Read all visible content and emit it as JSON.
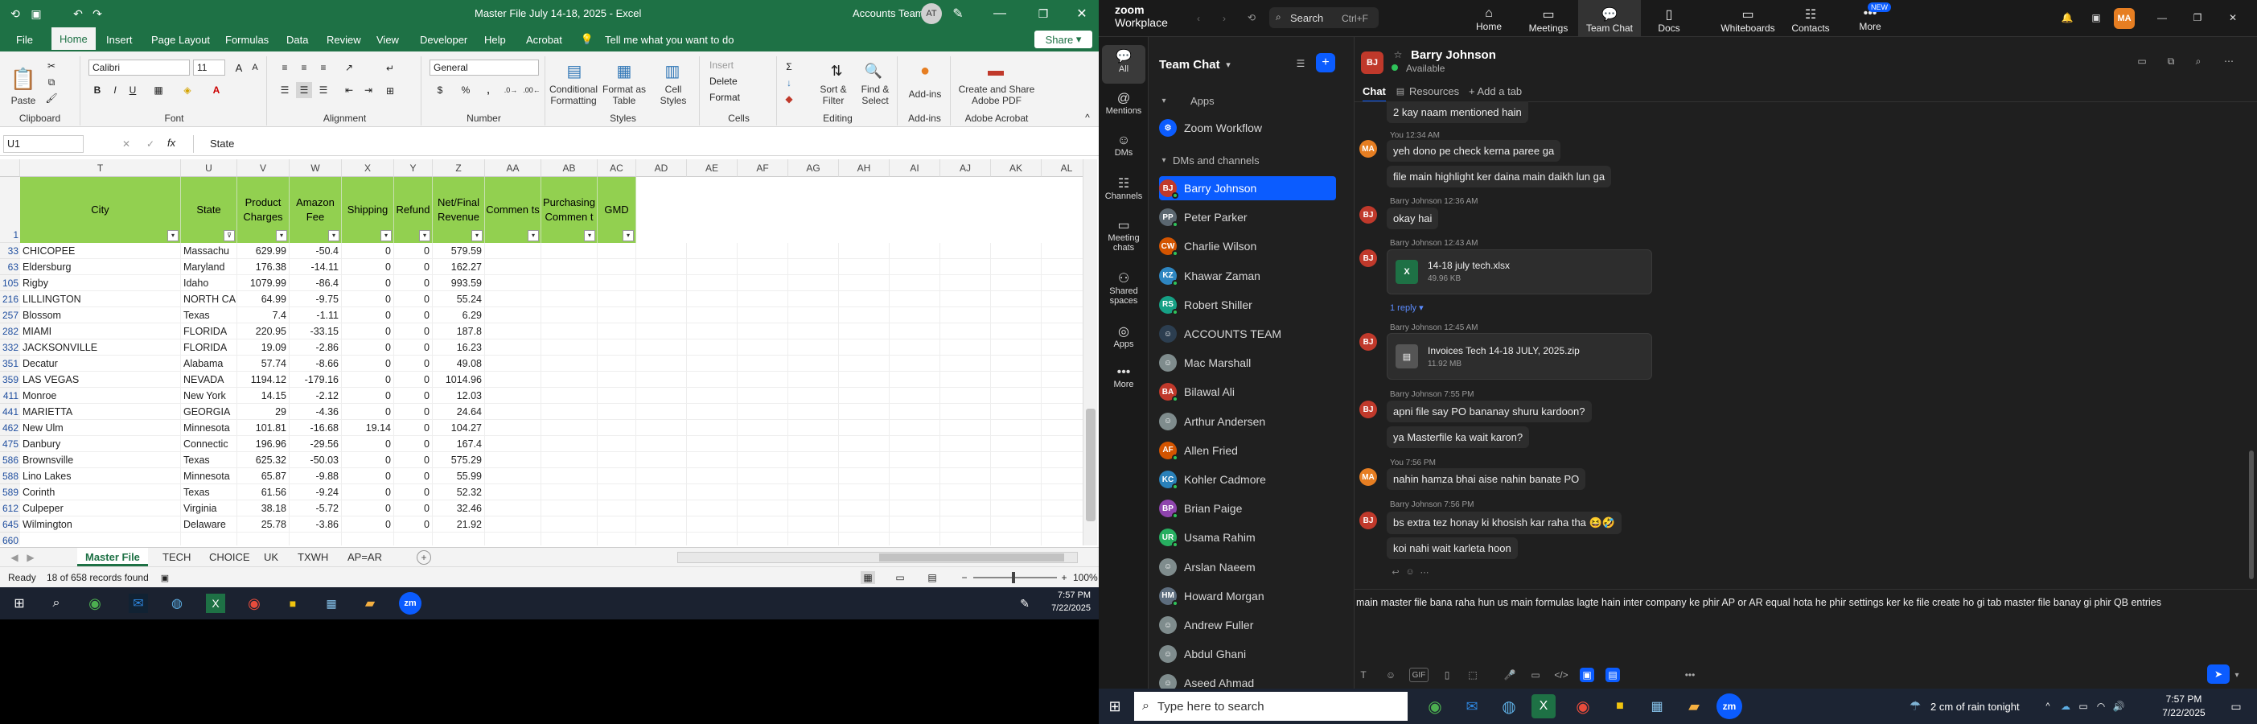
{
  "excel": {
    "title": "Master File July 14-18, 2025 - Excel",
    "account_name": "Accounts Team",
    "account_initials": "AT",
    "share": "Share",
    "tabs": [
      "File",
      "Home",
      "Insert",
      "Page Layout",
      "Formulas",
      "Data",
      "Review",
      "View",
      "Developer",
      "Help",
      "Acrobat"
    ],
    "tell_me": "Tell me what you want to do",
    "ribbon": {
      "font_name": "Calibri",
      "font_size": "11",
      "number_format": "General",
      "groups": {
        "clipboard": "Clipboard",
        "font": "Font",
        "alignment": "Alignment",
        "number": "Number",
        "styles": "Styles",
        "cells": "Cells",
        "editing": "Editing",
        "addins": "Add-ins",
        "acrobat": "Adobe Acrobat"
      },
      "paste": "Paste",
      "cond_format": "Conditional Formatting",
      "format_table": "Format as Table",
      "cell_styles": "Cell Styles",
      "insert": "Insert",
      "delete": "Delete",
      "format": "Format",
      "sort_filter": "Sort & Filter",
      "find_select": "Find & Select",
      "addins": "Add-ins",
      "create_pdf": "Create and Share Adobe PDF"
    },
    "name_box": "U1",
    "fx": "fx",
    "formula_value": "State",
    "col_letters": [
      "T",
      "U",
      "V",
      "W",
      "X",
      "Y",
      "Z",
      "AA",
      "AB",
      "AC",
      "AD",
      "AE",
      "AF",
      "AG",
      "AH",
      "AI",
      "AJ",
      "AK",
      "AL"
    ],
    "headers": [
      "City",
      "State",
      "Product Charges",
      "Amazon Fee",
      "Shipping",
      "Refund",
      "Net/Final Revenue",
      "Commen ts",
      "Purchasing Commen t",
      "GMD"
    ],
    "header_row_num": "1",
    "rows": [
      [
        "33",
        "CHICOPEE",
        "Massachu",
        "629.99",
        "-50.4",
        "0",
        "0",
        "579.59"
      ],
      [
        "63",
        "Eldersburg",
        "Maryland",
        "176.38",
        "-14.11",
        "0",
        "0",
        "162.27"
      ],
      [
        "105",
        "Rigby",
        "Idaho",
        "1079.99",
        "-86.4",
        "0",
        "0",
        "993.59"
      ],
      [
        "216",
        "LILLINGTON",
        "NORTH CA",
        "64.99",
        "-9.75",
        "0",
        "0",
        "55.24"
      ],
      [
        "257",
        "Blossom",
        "Texas",
        "7.4",
        "-1.11",
        "0",
        "0",
        "6.29"
      ],
      [
        "282",
        "MIAMI",
        "FLORIDA",
        "220.95",
        "-33.15",
        "0",
        "0",
        "187.8"
      ],
      [
        "332",
        "JACKSONVILLE",
        "FLORIDA",
        "19.09",
        "-2.86",
        "0",
        "0",
        "16.23"
      ],
      [
        "351",
        "Decatur",
        "Alabama",
        "57.74",
        "-8.66",
        "0",
        "0",
        "49.08"
      ],
      [
        "359",
        "LAS VEGAS",
        "NEVADA",
        "1194.12",
        "-179.16",
        "0",
        "0",
        "1014.96"
      ],
      [
        "411",
        "Monroe",
        "New York",
        "14.15",
        "-2.12",
        "0",
        "0",
        "12.03"
      ],
      [
        "441",
        "MARIETTA",
        "GEORGIA",
        "29",
        "-4.36",
        "0",
        "0",
        "24.64"
      ],
      [
        "462",
        "New Ulm",
        "Minnesota",
        "101.81",
        "-16.68",
        "19.14",
        "0",
        "104.27"
      ],
      [
        "475",
        "Danbury",
        "Connectic",
        "196.96",
        "-29.56",
        "0",
        "0",
        "167.4"
      ],
      [
        "586",
        "Brownsville",
        "Texas",
        "625.32",
        "-50.03",
        "0",
        "0",
        "575.29"
      ],
      [
        "588",
        "Lino Lakes",
        "Minnesota",
        "65.87",
        "-9.88",
        "0",
        "0",
        "55.99"
      ],
      [
        "589",
        "Corinth",
        "Texas",
        "61.56",
        "-9.24",
        "0",
        "0",
        "52.32"
      ],
      [
        "612",
        "Culpeper",
        "Virginia",
        "38.18",
        "-5.72",
        "0",
        "0",
        "32.46"
      ],
      [
        "645",
        "Wilmington",
        "Delaware",
        "25.78",
        "-3.86",
        "0",
        "0",
        "21.92"
      ],
      [
        "660",
        "",
        "",
        "",
        "",
        "",
        "",
        ""
      ]
    ],
    "sheets": [
      "Master File",
      "TECH",
      "CHOICE",
      "UK",
      "TXWH",
      "AP=AR"
    ],
    "status_ready": "Ready",
    "status_records": "18 of 658 records found",
    "zoom": "100%"
  },
  "win_taskbar": {
    "time": "7:57 PM",
    "date": "7/22/2025"
  },
  "zoom": {
    "logo_line1": "zoom",
    "logo_line2": "Workplace",
    "search": "Search",
    "search_shortcut": "Ctrl+F",
    "top_nav": [
      "Home",
      "Meetings",
      "Team Chat",
      "Docs",
      "Whiteboards",
      "Contacts",
      "More"
    ],
    "new_badge": "NEW",
    "profile_initials": "MA",
    "rail": [
      "All",
      "Mentions",
      "DMs",
      "Channels",
      "Meeting chats",
      "Shared spaces",
      "Apps",
      "More"
    ],
    "sidebar_title": "Team Chat",
    "apps_section": "Apps",
    "zoom_workflow": "Zoom Workflow",
    "dms_section": "DMs and channels",
    "contacts": [
      {
        "initials": "BJ",
        "name": "Barry Johnson",
        "color": "#c0392b"
      },
      {
        "initials": "PP",
        "name": "Peter Parker",
        "color": "#5b6770"
      },
      {
        "initials": "CW",
        "name": "Charlie Wilson",
        "color": "#d35400"
      },
      {
        "initials": "KZ",
        "name": "Khawar Zaman",
        "color": "#2e86c1"
      },
      {
        "initials": "RS",
        "name": "Robert Shiller",
        "color": "#16a085"
      },
      {
        "initials": "",
        "name": "ACCOUNTS TEAM",
        "color": "#2c3e50"
      },
      {
        "initials": "",
        "name": "Mac Marshall",
        "color": "#7f8c8d"
      },
      {
        "initials": "BA",
        "name": "Bilawal Ali",
        "color": "#c0392b"
      },
      {
        "initials": "",
        "name": "Arthur Andersen",
        "color": "#7f8c8d"
      },
      {
        "initials": "AF",
        "name": "Allen Fried",
        "color": "#d35400"
      },
      {
        "initials": "KC",
        "name": "Kohler Cadmore",
        "color": "#2980b9"
      },
      {
        "initials": "BP",
        "name": "Brian Paige",
        "color": "#8e44ad"
      },
      {
        "initials": "UR",
        "name": "Usama Rahim",
        "color": "#27ae60"
      },
      {
        "initials": "",
        "name": "Arslan Naeem",
        "color": "#7f8c8d"
      },
      {
        "initials": "HM",
        "name": "Howard Morgan",
        "color": "#5d6d7e"
      },
      {
        "initials": "",
        "name": "Andrew Fuller",
        "color": "#7f8c8d"
      },
      {
        "initials": "",
        "name": "Abdul Ghani",
        "color": "#7f8c8d"
      },
      {
        "initials": "",
        "name": "Aseed Ahmad",
        "color": "#7f8c8d"
      }
    ],
    "chat_user": "Barry Johnson",
    "chat_status": "Available",
    "chat_tabs": [
      "Chat",
      "Resources",
      "Add a tab"
    ],
    "messages": {
      "m0": "2 kay naam mentioned hain",
      "m1_meta": "You 12:34 AM",
      "m1": "yeh dono pe check kerna paree ga",
      "m1b": "file main highlight ker daina main daikh lun ga",
      "m2_meta": "Barry Johnson 12:36 AM",
      "m2": "okay hai",
      "m3_meta": "Barry Johnson 12:43 AM",
      "file1_name": "14-18 july tech.xlsx",
      "file1_size": "49.96 KB",
      "reply": "1 reply",
      "m4_meta": "Barry Johnson 12:45 AM",
      "file2_name": "Invoices Tech 14-18 JULY, 2025.zip",
      "file2_size": "11.92 MB",
      "m5_meta": "Barry Johnson 7:55 PM",
      "m5": "apni file say PO bananay shuru kardoon?",
      "m5b": "ya Masterfile ka wait karon?",
      "m6_meta": "You 7:56 PM",
      "m6": "nahin hamza bhai aise nahin banate PO",
      "m7_meta": "Barry Johnson 7:56 PM",
      "m7": "bs extra tez honay ki khosish kar raha tha 😆🤣",
      "m7b": "koi nahi wait karleta hoon"
    },
    "compose_text": "main master file bana raha hun us main formulas lagte hain inter company ke phir AP or AR equal hota he phir settings ker ke file create ho gi tab master file banay gi phir QB entries",
    "compose_gif": "GIF"
  },
  "zoom_taskbar": {
    "search_placeholder": "Type here to search",
    "weather": "2 cm of rain tonight",
    "time": "7:57 PM",
    "date": "7/22/2025"
  },
  "colors": {
    "excel_green": "#1e7145",
    "header_green": "#92d050",
    "zoom_accent": "#0b5cff"
  }
}
